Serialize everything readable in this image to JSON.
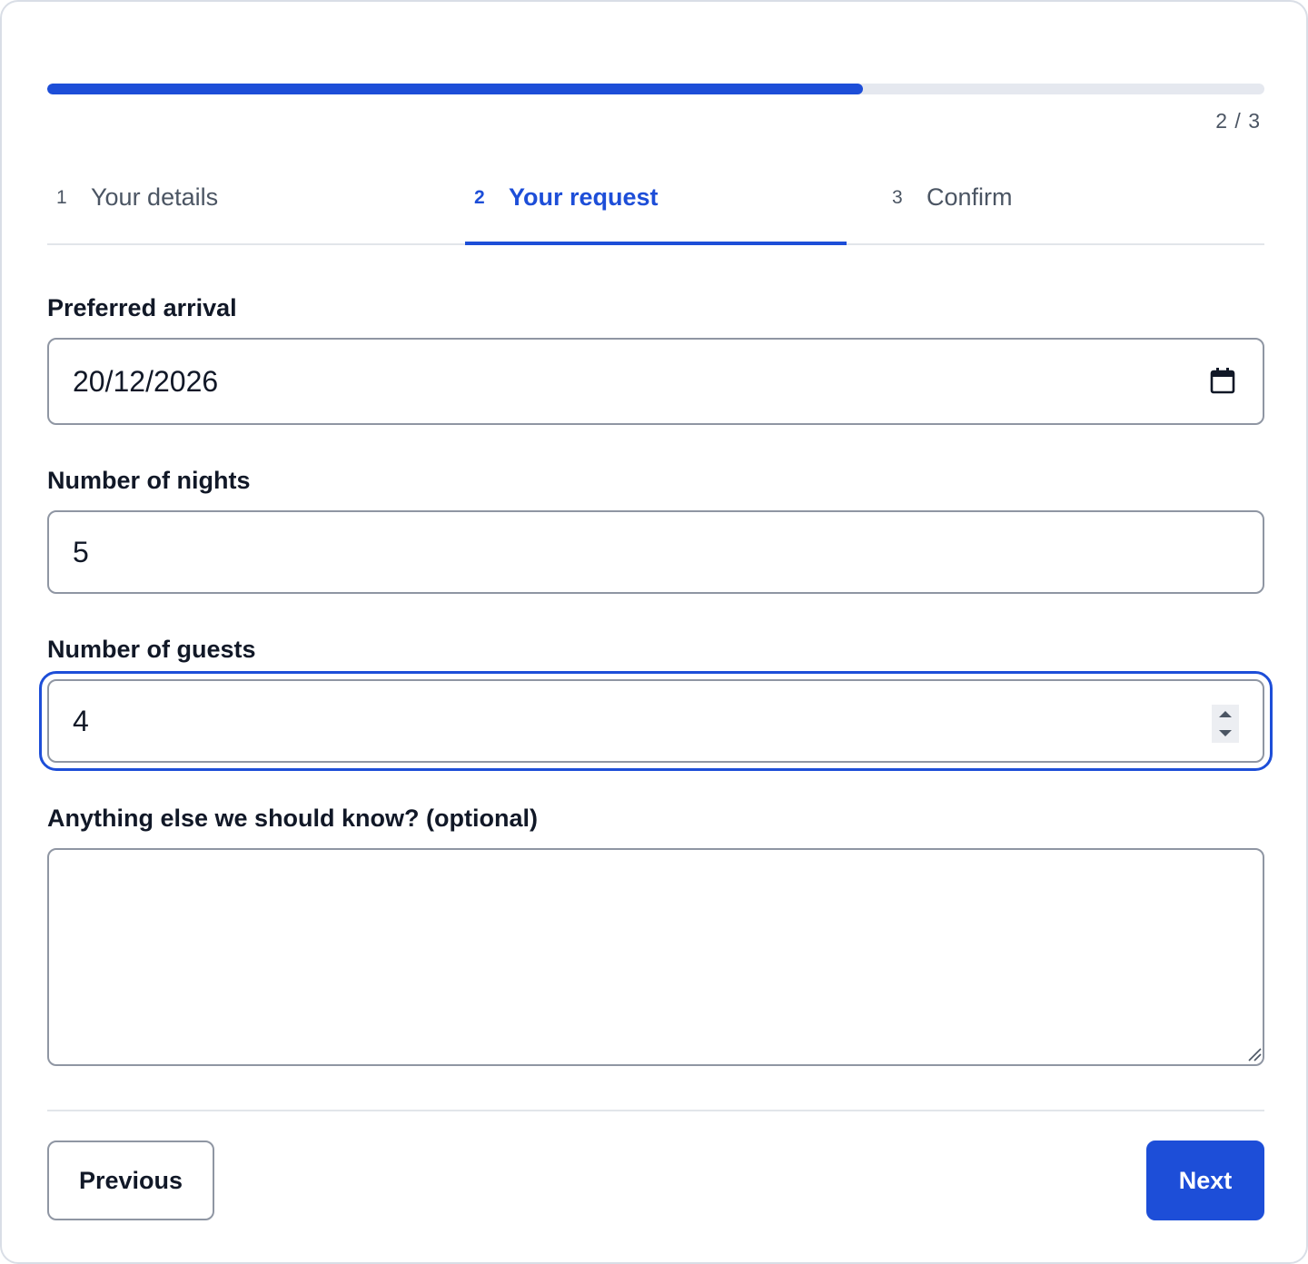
{
  "progress": {
    "fraction": 0.67,
    "label": "2 / 3",
    "color": "#1d4ed8"
  },
  "steps": [
    {
      "number": "1",
      "label": "Your details"
    },
    {
      "number": "2",
      "label": "Your request",
      "active": true
    },
    {
      "number": "3",
      "label": "Confirm"
    }
  ],
  "form": {
    "arrival": {
      "label": "Preferred arrival",
      "value": "20/12/2026",
      "icon": "calendar-icon"
    },
    "nights": {
      "label": "Number of nights",
      "value": "5"
    },
    "guests": {
      "label": "Number of guests",
      "value": "4",
      "icon": "spinner-icon"
    },
    "notes": {
      "label": "Anything else we should know? (optional)",
      "value": ""
    }
  },
  "actions": {
    "previous_label": "Previous",
    "next_label": "Next"
  }
}
